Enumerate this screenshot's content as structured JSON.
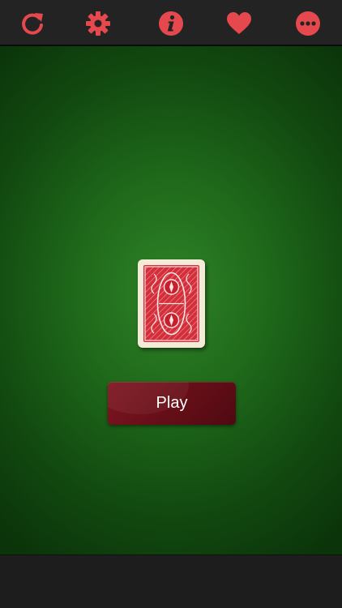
{
  "toolbar": {
    "background": "#232323",
    "icon_color": "#e5484d",
    "buttons": [
      {
        "id": "restart",
        "icon": "refresh-icon"
      },
      {
        "id": "settings",
        "icon": "gear-icon"
      },
      {
        "id": "info",
        "icon": "info-icon"
      },
      {
        "id": "favorite",
        "icon": "heart-icon"
      },
      {
        "id": "more",
        "icon": "more-dots-icon"
      }
    ]
  },
  "table": {
    "felt_color": "#1f6a1b",
    "card": {
      "face": "back",
      "back_color": "#d32f3a",
      "border_color": "#f4ead8"
    }
  },
  "play_button": {
    "label": "Play",
    "color": "#6a0f19"
  }
}
